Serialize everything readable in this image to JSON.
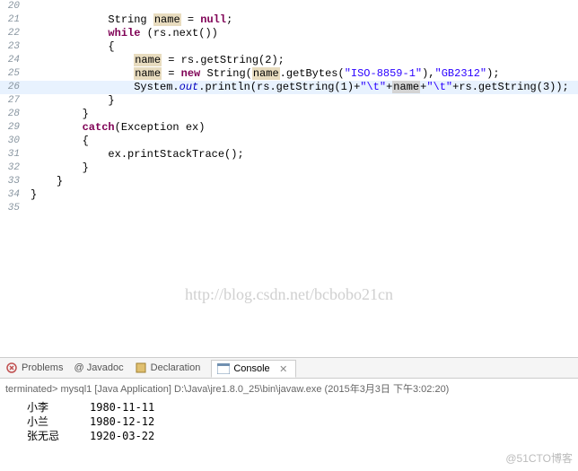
{
  "code": {
    "lines": [
      {
        "n": "20"
      },
      {
        "n": "21",
        "indent": "            ",
        "tokens": [
          {
            "t": "String ",
            "c": ""
          },
          {
            "t": "name",
            "c": "var-hl"
          },
          {
            "t": " = ",
            "c": ""
          },
          {
            "t": "null",
            "c": "kw"
          },
          {
            "t": ";",
            "c": ""
          }
        ]
      },
      {
        "n": "22",
        "indent": "            ",
        "tokens": [
          {
            "t": "while",
            "c": "kw"
          },
          {
            "t": " (rs.next())",
            "c": ""
          }
        ]
      },
      {
        "n": "23",
        "indent": "            ",
        "tokens": [
          {
            "t": "{",
            "c": ""
          }
        ]
      },
      {
        "n": "24",
        "indent": "                ",
        "tokens": [
          {
            "t": "name",
            "c": "var-hl"
          },
          {
            "t": " = rs.getString(2);",
            "c": ""
          }
        ]
      },
      {
        "n": "25",
        "indent": "                ",
        "tokens": [
          {
            "t": "name",
            "c": "var-hl"
          },
          {
            "t": " = ",
            "c": ""
          },
          {
            "t": "new",
            "c": "kw"
          },
          {
            "t": " String(",
            "c": ""
          },
          {
            "t": "name",
            "c": "var-hl"
          },
          {
            "t": ".getBytes(",
            "c": ""
          },
          {
            "t": "\"ISO-8859-1\"",
            "c": "str"
          },
          {
            "t": "),",
            "c": ""
          },
          {
            "t": "\"GB2312\"",
            "c": "str"
          },
          {
            "t": ");",
            "c": ""
          }
        ]
      },
      {
        "n": "26",
        "hl": true,
        "indent": "                ",
        "tokens": [
          {
            "t": "System.",
            "c": ""
          },
          {
            "t": "out",
            "c": "fld italic"
          },
          {
            "t": ".println(rs.getString(1)+",
            "c": ""
          },
          {
            "t": "\"\\t\"",
            "c": "str"
          },
          {
            "t": "+",
            "c": ""
          },
          {
            "t": "name",
            "c": "var-hl-sel"
          },
          {
            "t": "+",
            "c": ""
          },
          {
            "t": "\"\\t\"",
            "c": "str"
          },
          {
            "t": "+rs.getString(3));",
            "c": ""
          }
        ]
      },
      {
        "n": "27",
        "indent": "            ",
        "tokens": [
          {
            "t": "}",
            "c": ""
          }
        ]
      },
      {
        "n": "28",
        "indent": "        ",
        "tokens": [
          {
            "t": "}",
            "c": ""
          }
        ]
      },
      {
        "n": "29",
        "indent": "        ",
        "tokens": [
          {
            "t": "catch",
            "c": "kw"
          },
          {
            "t": "(Exception ex)",
            "c": ""
          }
        ]
      },
      {
        "n": "30",
        "indent": "        ",
        "tokens": [
          {
            "t": "{",
            "c": ""
          }
        ]
      },
      {
        "n": "31",
        "indent": "            ",
        "tokens": [
          {
            "t": "ex.printStackTrace();",
            "c": ""
          }
        ]
      },
      {
        "n": "32",
        "indent": "        ",
        "tokens": [
          {
            "t": "}",
            "c": ""
          }
        ]
      },
      {
        "n": "33",
        "indent": "    ",
        "tokens": [
          {
            "t": "}",
            "c": ""
          }
        ]
      },
      {
        "n": "34",
        "indent": "",
        "tokens": [
          {
            "t": "}",
            "c": ""
          }
        ]
      },
      {
        "n": "35"
      }
    ]
  },
  "watermark": "http://blog.csdn.net/bcbobo21cn",
  "tabs": {
    "problems": "Problems",
    "javadoc": "@ Javadoc",
    "declaration": "Declaration",
    "console": "Console"
  },
  "console": {
    "header": "terminated> mysql1 [Java Application] D:\\Java\\jre1.8.0_25\\bin\\javaw.exe (2015年3月3日 下午3:02:20)",
    "rows": [
      {
        "c1": "小李",
        "c2": "1980-11-11"
      },
      {
        "c1": "小兰",
        "c2": "1980-12-12"
      },
      {
        "c1": "张无忌",
        "c2": "1920-03-22"
      }
    ]
  },
  "corner": "@51CTO博客"
}
